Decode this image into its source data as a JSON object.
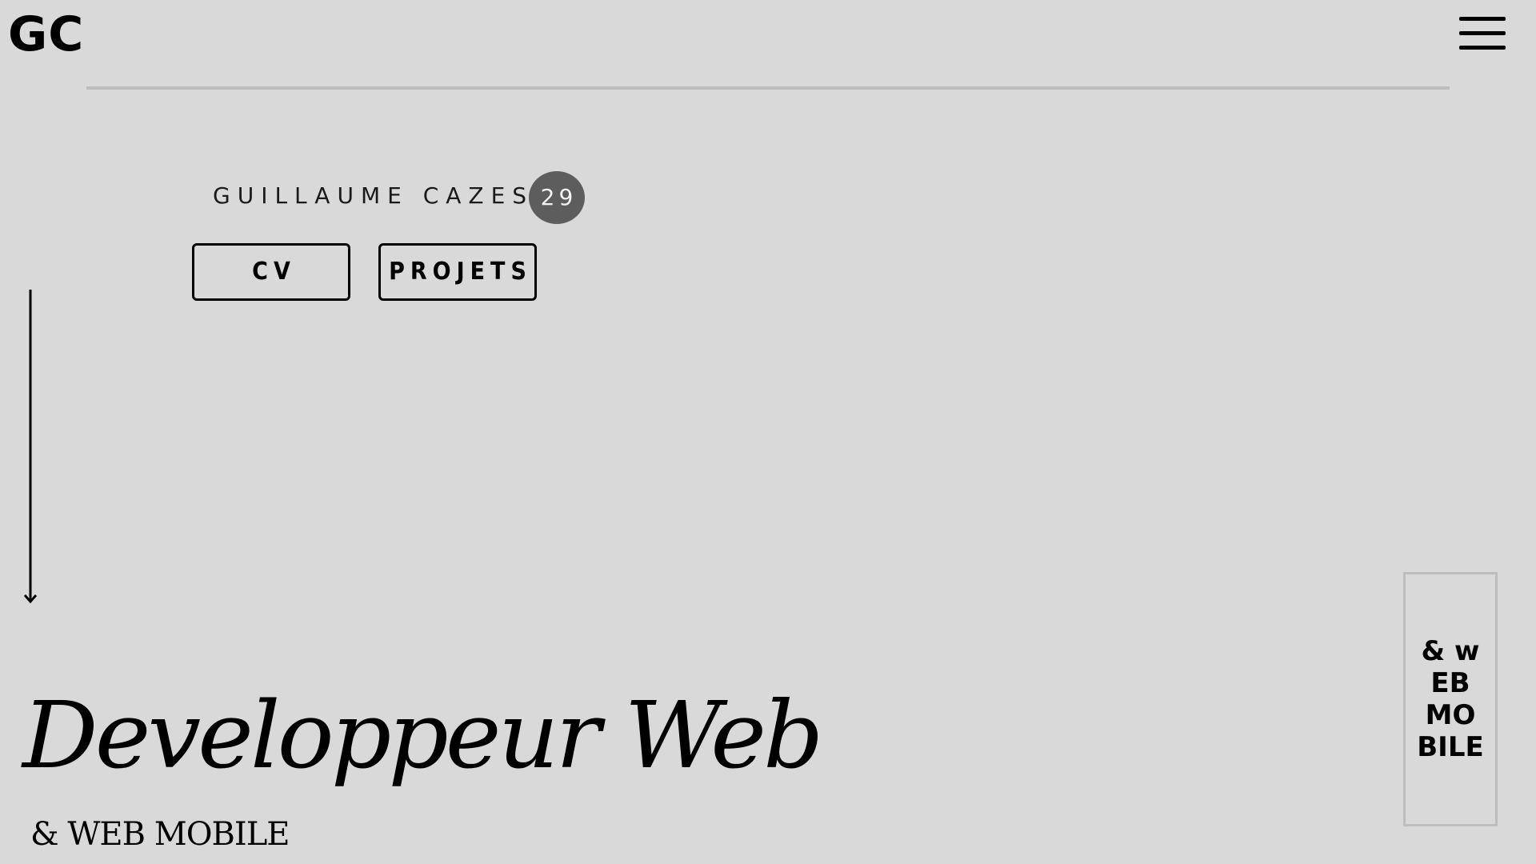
{
  "header": {
    "logo": "GC",
    "menu_icon": "hamburger-menu-icon"
  },
  "intro": {
    "name": "GUILLAUME CAZES",
    "age": "29",
    "buttons": {
      "cv_label": "CV",
      "projets_label": "PROJETS"
    }
  },
  "scroll": {
    "icon": "arrow-down-icon"
  },
  "hero": {
    "title": "Developpeur Web",
    "subtitle": "& WEB MOBILE"
  },
  "side_box": {
    "text": "& wEB MOBILE"
  },
  "colors": {
    "background": "#d9d9d9",
    "rule": "#bdbdbd",
    "badge": "#5d5d5d",
    "text": "#000000"
  }
}
